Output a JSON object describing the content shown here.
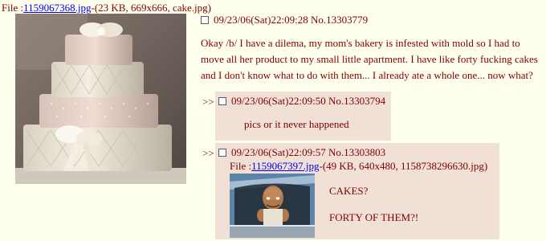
{
  "op": {
    "file_prefix": "File :",
    "file_link": "1159067368.jpg",
    "file_info": "-(23 KB, 669x666, cake.jpg)",
    "datetime": "09/23/06(Sat)22:09:28",
    "post_no": "No.13303779",
    "message": "Okay /b/ I have a dilema, my mom's bakery is infested with mold so I had to move all her product to my small little apartment. I have like forty fucking cakes and I don't know what to do with them... I already ate a whole one... now what?",
    "image_icon": "tiered-wedding-cake-image"
  },
  "replies": [
    {
      "arrows": ">>",
      "datetime": "09/23/06(Sat)22:09:50",
      "post_no": "No.13303794",
      "message": "pics or it never happened"
    },
    {
      "arrows": ">>",
      "datetime": "09/23/06(Sat)22:09:57",
      "post_no": "No.13303803",
      "file_prefix": "File :",
      "file_link": "1159067397.jpg",
      "file_info": "-(49 KB, 640x480, 1158738296630.jpg)",
      "message_line1": "CAKES?",
      "message_line2": "FORTY OF THEM?!",
      "image_icon": "cartoon-man-in-car-window-image"
    }
  ],
  "colors": {
    "background": "#FFFFEE",
    "text": "#800000",
    "link": "#0000EE",
    "reply_bg": "#F0E0D6"
  }
}
